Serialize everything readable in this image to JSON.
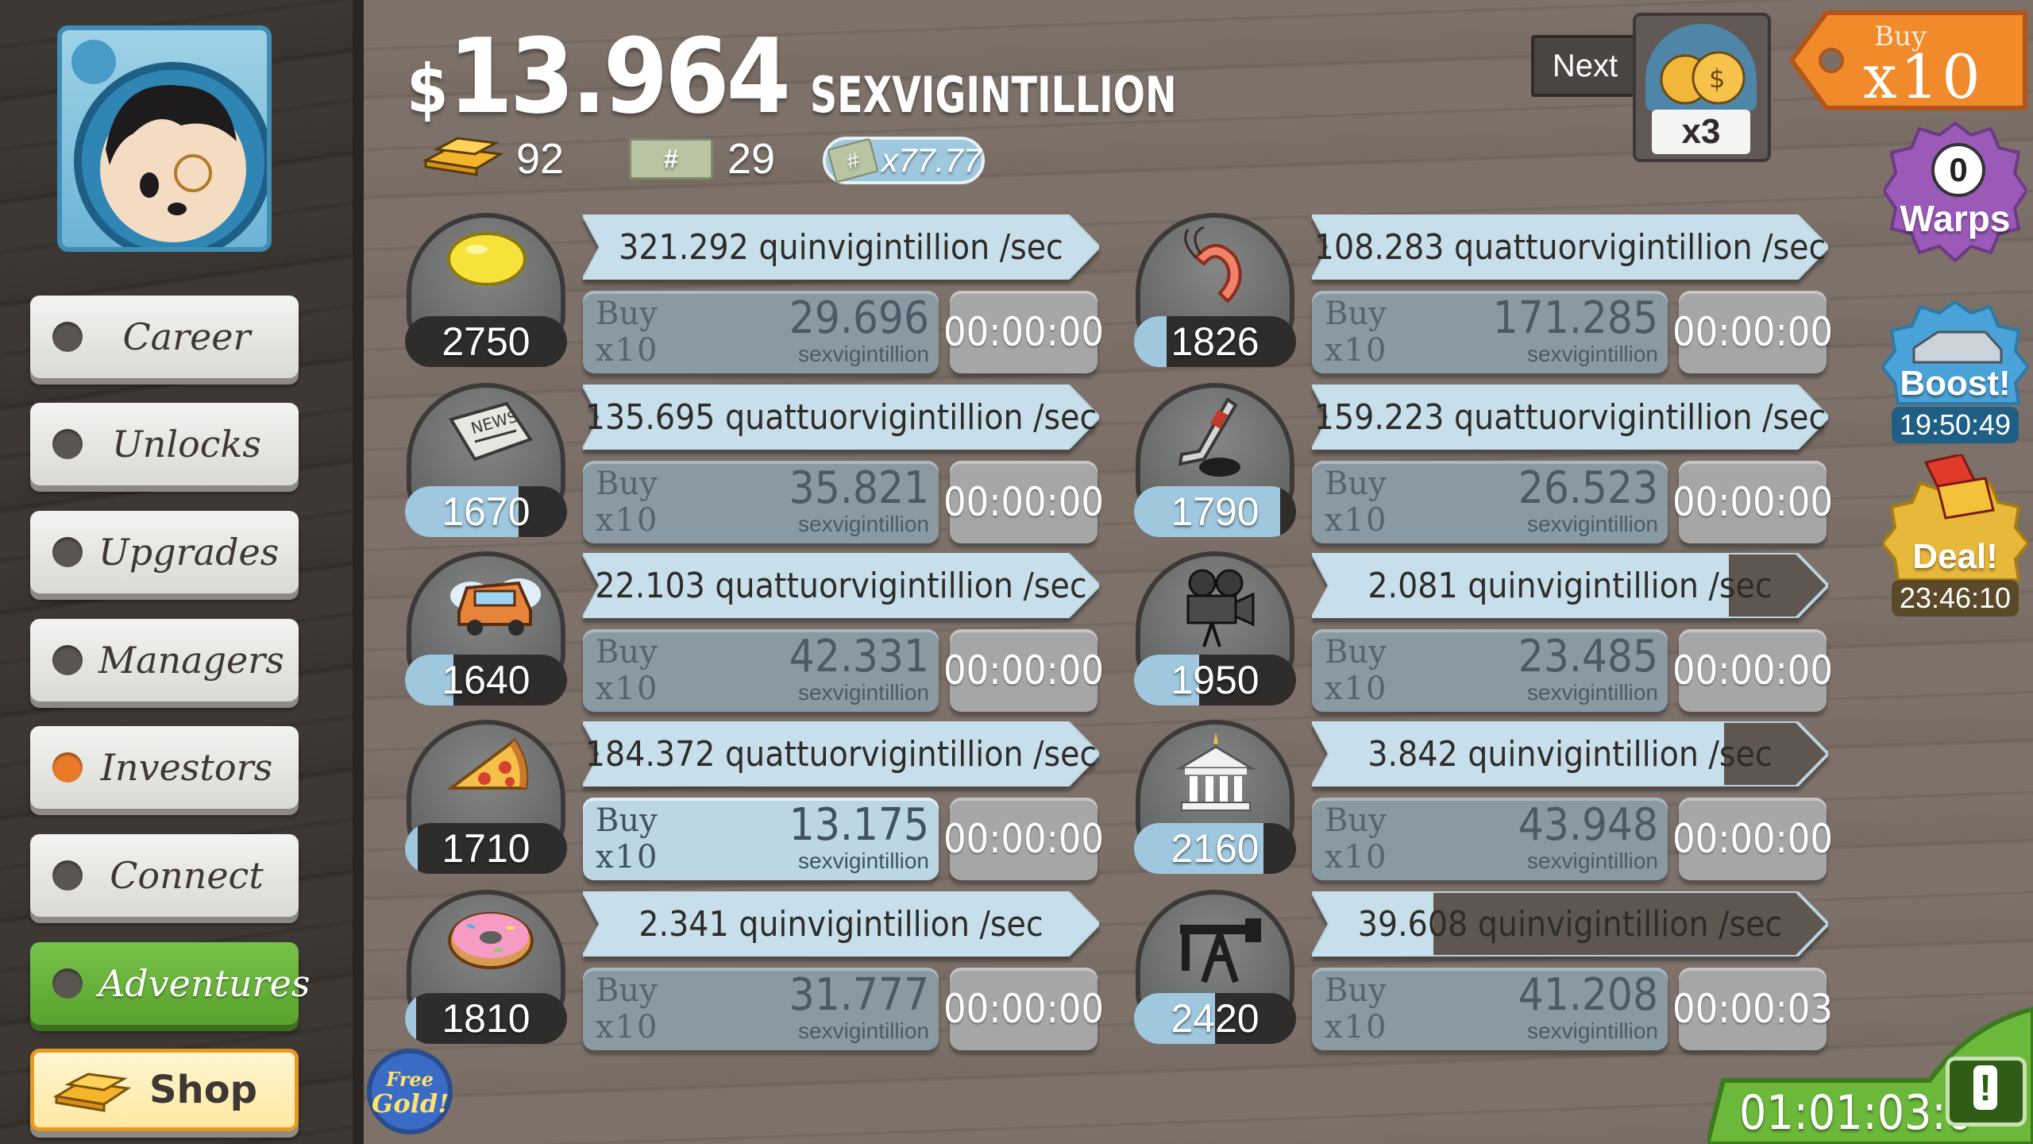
{
  "header": {
    "currency_symbol": "$",
    "amount": "13.964",
    "amount_unit": "SEXVIGINTILLION",
    "gold_count": "92",
    "megabucks_count": "29",
    "multiplier": "x77.77",
    "next_label": "Next",
    "next_reward": "x3",
    "buy_label": "Buy",
    "buy_multiplier": "x10"
  },
  "sidebar": {
    "items": [
      {
        "label": "Career"
      },
      {
        "label": "Unlocks"
      },
      {
        "label": "Upgrades"
      },
      {
        "label": "Managers"
      },
      {
        "label": "Investors"
      },
      {
        "label": "Connect"
      },
      {
        "label": "Adventures"
      },
      {
        "label": "Shop"
      }
    ]
  },
  "businesses": [
    {
      "icon": "lemon-icon",
      "count": "2750",
      "progress": 0.0,
      "rate": "321.292 quinvigintillion /sec",
      "rate_fill": 1.0,
      "buy1": "Buy",
      "buy2": "x10",
      "price": "29.696",
      "price_unit": "sexvigintillion",
      "timer": "00:00:00"
    },
    {
      "icon": "shrimp-icon",
      "count": "1826",
      "progress": 0.2,
      "rate": "108.283 quattuorvigintillion /sec",
      "rate_fill": 1.0,
      "buy1": "Buy",
      "buy2": "x10",
      "price": "171.285",
      "price_unit": "sexvigintillion",
      "timer": "00:00:00"
    },
    {
      "icon": "newspaper-icon",
      "count": "1670",
      "progress": 0.7,
      "rate": "135.695 quattuorvigintillion /sec",
      "rate_fill": 1.0,
      "buy1": "Buy",
      "buy2": "x10",
      "price": "35.821",
      "price_unit": "sexvigintillion",
      "timer": "00:00:00"
    },
    {
      "icon": "hockey-icon",
      "count": "1790",
      "progress": 0.9,
      "rate": "159.223 quattuorvigintillion /sec",
      "rate_fill": 1.0,
      "buy1": "Buy",
      "buy2": "x10",
      "price": "26.523",
      "price_unit": "sexvigintillion",
      "timer": "00:00:00"
    },
    {
      "icon": "car-icon",
      "count": "1640",
      "progress": 0.3,
      "rate": "22.103 quattuorvigintillion /sec",
      "rate_fill": 1.0,
      "buy1": "Buy",
      "buy2": "x10",
      "price": "42.331",
      "price_unit": "sexvigintillion",
      "timer": "00:00:00"
    },
    {
      "icon": "movie-camera-icon",
      "count": "1950",
      "progress": 0.4,
      "rate": "2.081 quinvigintillion /sec",
      "rate_fill": 0.86,
      "buy1": "Buy",
      "buy2": "x10",
      "price": "23.485",
      "price_unit": "sexvigintillion",
      "timer": "00:00:00"
    },
    {
      "icon": "pizza-icon",
      "count": "1710",
      "progress": 0.08,
      "rate": "184.372 quattuorvigintillion /sec",
      "rate_fill": 1.0,
      "buy1": "Buy",
      "buy2": "x10",
      "price": "13.175",
      "price_unit": "sexvigintillion",
      "timer": "00:00:00",
      "affordable": true
    },
    {
      "icon": "bank-icon",
      "count": "2160",
      "progress": 0.8,
      "rate": "3.842 quinvigintillion /sec",
      "rate_fill": 0.85,
      "buy1": "Buy",
      "buy2": "x10",
      "price": "43.948",
      "price_unit": "sexvigintillion",
      "timer": "00:00:00"
    },
    {
      "icon": "donut-icon",
      "count": "1810",
      "progress": 0.07,
      "rate": "2.341 quinvigintillion /sec",
      "rate_fill": 1.0,
      "buy1": "Buy",
      "buy2": "x10",
      "price": "31.777",
      "price_unit": "sexvigintillion",
      "timer": "00:00:00"
    },
    {
      "icon": "oil-rig-icon",
      "count": "2420",
      "progress": 0.5,
      "rate": "39.608 quinvigintillion /sec",
      "rate_fill": 0.25,
      "buy1": "Buy",
      "buy2": "x10",
      "price": "41.208",
      "price_unit": "sexvigintillion",
      "timer": "00:00:03"
    }
  ],
  "right_panel": {
    "warps_count": "0",
    "warps_label": "Warps",
    "boost_label": "Boost!",
    "boost_timer": "19:50:49",
    "deal_label": "Deal!",
    "deal_timer": "23:46:10"
  },
  "footer": {
    "free_gold_1": "Free",
    "free_gold_2": "Gold!",
    "tv_timer": "01:01:03:0"
  },
  "colors": {
    "accent_green": "#6cb83b",
    "shop_orange": "#e89a26",
    "progress_blue": "#9fc8df"
  }
}
